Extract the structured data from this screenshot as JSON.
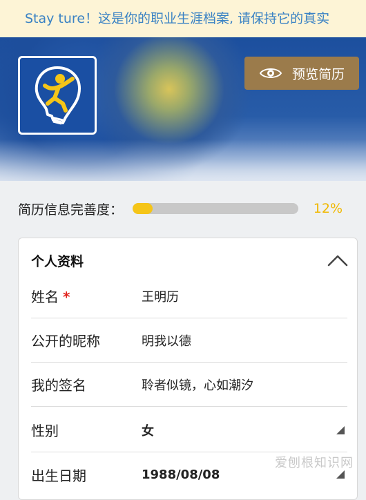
{
  "banner": {
    "text": "Stay ture！这是你的职业生涯档案, 请保持它的真实"
  },
  "header": {
    "logo_icon": "lightbulb-person-logo",
    "preview_button_label": "预览简历",
    "preview_icon": "eye-icon"
  },
  "completeness": {
    "label": "简历信息完善度：",
    "percent_text": "12%",
    "percent_value": 12,
    "fill_color": "#f5c518"
  },
  "profile": {
    "title": "个人资料",
    "fields": [
      {
        "label": "姓名",
        "required_mark": "*",
        "value": "王明历"
      },
      {
        "label": "公开的昵称",
        "value": "明我以德"
      },
      {
        "label": "我的签名",
        "value": "聆者似镜，心如潮汐"
      },
      {
        "label": "性别",
        "value": "女"
      },
      {
        "label": "出生日期",
        "value": "1988/08/08"
      }
    ]
  },
  "watermark": {
    "text": "爱刨根知识网"
  },
  "colors": {
    "banner_bg": "#fdf4d6",
    "banner_text": "#3a82c4",
    "button_bg": "#9b7b4b",
    "accent": "#f0b800"
  }
}
